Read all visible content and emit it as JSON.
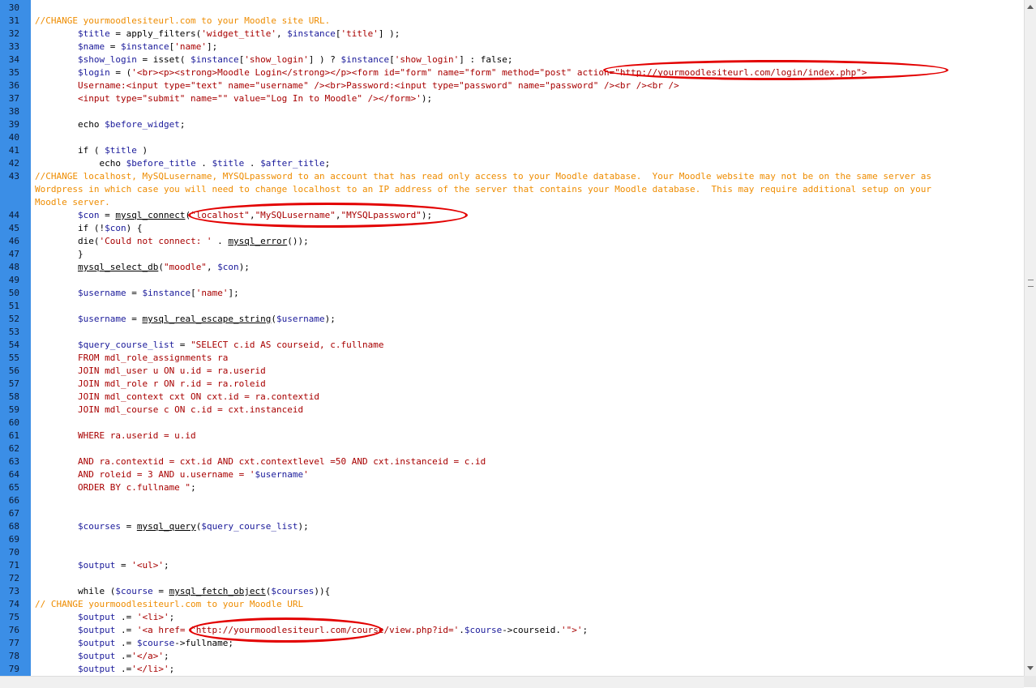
{
  "editor": {
    "lines": [
      {
        "n": "30",
        "segs": []
      },
      {
        "n": "31",
        "segs": [
          {
            "c": "cm",
            "t": "//CHANGE yourmoodlesiteurl.com to your Moodle site URL."
          }
        ]
      },
      {
        "n": "32",
        "segs": [
          {
            "c": "vr",
            "t": "        $title"
          },
          {
            "c": "pl",
            "t": " = apply_filters("
          },
          {
            "c": "st",
            "t": "'widget_title'"
          },
          {
            "c": "pl",
            "t": ", "
          },
          {
            "c": "vr",
            "t": "$instance"
          },
          {
            "c": "pl",
            "t": "["
          },
          {
            "c": "st",
            "t": "'title'"
          },
          {
            "c": "pl",
            "t": "] );"
          }
        ]
      },
      {
        "n": "33",
        "segs": [
          {
            "c": "vr",
            "t": "        $name"
          },
          {
            "c": "pl",
            "t": " = "
          },
          {
            "c": "vr",
            "t": "$instance"
          },
          {
            "c": "pl",
            "t": "["
          },
          {
            "c": "st",
            "t": "'name'"
          },
          {
            "c": "pl",
            "t": "];"
          }
        ]
      },
      {
        "n": "34",
        "segs": [
          {
            "c": "vr",
            "t": "        $show_login"
          },
          {
            "c": "pl",
            "t": " = isset( "
          },
          {
            "c": "vr",
            "t": "$instance"
          },
          {
            "c": "pl",
            "t": "["
          },
          {
            "c": "st",
            "t": "'show_login'"
          },
          {
            "c": "pl",
            "t": "] ) ? "
          },
          {
            "c": "vr",
            "t": "$instance"
          },
          {
            "c": "pl",
            "t": "["
          },
          {
            "c": "st",
            "t": "'show_login'"
          },
          {
            "c": "pl",
            "t": "] : false;"
          }
        ]
      },
      {
        "n": "35",
        "segs": [
          {
            "c": "vr",
            "t": "        $login"
          },
          {
            "c": "pl",
            "t": " = ("
          },
          {
            "c": "st",
            "t": "'<br><p><strong>Moodle Login</strong></p><form id=\"form\" name=\"form\" method=\"post\" action=\"http://yourmoodlesiteurl.com/login/index.php\">"
          }
        ]
      },
      {
        "n": "36",
        "segs": [
          {
            "c": "st",
            "t": "        Username:<input type=\"text\" name=\"username\" /><br>Password:<input type=\"password\" name=\"password\" /><br /><br />"
          }
        ]
      },
      {
        "n": "37",
        "segs": [
          {
            "c": "st",
            "t": "        <input type=\"submit\" name=\"\" value=\"Log In to Moodle\" /></form>'"
          },
          {
            "c": "pl",
            "t": ");"
          }
        ]
      },
      {
        "n": "38",
        "segs": []
      },
      {
        "n": "39",
        "segs": [
          {
            "c": "pl",
            "t": "        echo "
          },
          {
            "c": "vr",
            "t": "$before_widget"
          },
          {
            "c": "pl",
            "t": ";"
          }
        ]
      },
      {
        "n": "40",
        "segs": []
      },
      {
        "n": "41",
        "segs": [
          {
            "c": "pl",
            "t": "        if ( "
          },
          {
            "c": "vr",
            "t": "$title"
          },
          {
            "c": "pl",
            "t": " )"
          }
        ]
      },
      {
        "n": "42",
        "segs": [
          {
            "c": "pl",
            "t": "            echo "
          },
          {
            "c": "vr",
            "t": "$before_title"
          },
          {
            "c": "pl",
            "t": " . "
          },
          {
            "c": "vr",
            "t": "$title"
          },
          {
            "c": "pl",
            "t": " . "
          },
          {
            "c": "vr",
            "t": "$after_title"
          },
          {
            "c": "pl",
            "t": ";"
          }
        ]
      },
      {
        "n": "43",
        "segs": [
          {
            "c": "cm",
            "t": "//CHANGE localhost, MySQLusername, MYSQLpassword to an account that has read only access to your Moodle database.  Your Moodle website may not be on the same server as"
          }
        ]
      },
      {
        "n": "",
        "segs": [
          {
            "c": "cm",
            "t": "Wordpress in which case you will need to change localhost to an IP address of the server that contains your Moodle database.  This may require additional setup on your"
          }
        ]
      },
      {
        "n": "",
        "segs": [
          {
            "c": "cm",
            "t": "Moodle server."
          }
        ]
      },
      {
        "n": "44",
        "segs": [
          {
            "c": "vr",
            "t": "        $con"
          },
          {
            "c": "pl",
            "t": " = "
          },
          {
            "c": "fn",
            "t": "mysql_connect"
          },
          {
            "c": "pl",
            "t": "("
          },
          {
            "c": "st",
            "t": "\"localhost\""
          },
          {
            "c": "pl",
            "t": ","
          },
          {
            "c": "st",
            "t": "\"MySQLusername\""
          },
          {
            "c": "pl",
            "t": ","
          },
          {
            "c": "st",
            "t": "\"MYSQLpassword\""
          },
          {
            "c": "pl",
            "t": ");"
          }
        ]
      },
      {
        "n": "45",
        "segs": [
          {
            "c": "pl",
            "t": "        if (!"
          },
          {
            "c": "vr",
            "t": "$con"
          },
          {
            "c": "pl",
            "t": ") {"
          }
        ]
      },
      {
        "n": "46",
        "segs": [
          {
            "c": "pl",
            "t": "        die("
          },
          {
            "c": "st",
            "t": "'Could not connect: '"
          },
          {
            "c": "pl",
            "t": " . "
          },
          {
            "c": "fn",
            "t": "mysql_error"
          },
          {
            "c": "pl",
            "t": "());"
          }
        ]
      },
      {
        "n": "47",
        "segs": [
          {
            "c": "pl",
            "t": "        }"
          }
        ]
      },
      {
        "n": "48",
        "segs": [
          {
            "c": "pl",
            "t": "        "
          },
          {
            "c": "fn",
            "t": "mysql_select_db"
          },
          {
            "c": "pl",
            "t": "("
          },
          {
            "c": "st",
            "t": "\"moodle\""
          },
          {
            "c": "pl",
            "t": ", "
          },
          {
            "c": "vr",
            "t": "$con"
          },
          {
            "c": "pl",
            "t": ");"
          }
        ]
      },
      {
        "n": "49",
        "segs": []
      },
      {
        "n": "50",
        "segs": [
          {
            "c": "vr",
            "t": "        $username"
          },
          {
            "c": "pl",
            "t": " = "
          },
          {
            "c": "vr",
            "t": "$instance"
          },
          {
            "c": "pl",
            "t": "["
          },
          {
            "c": "st",
            "t": "'name'"
          },
          {
            "c": "pl",
            "t": "];"
          }
        ]
      },
      {
        "n": "51",
        "segs": []
      },
      {
        "n": "52",
        "segs": [
          {
            "c": "vr",
            "t": "        $username"
          },
          {
            "c": "pl",
            "t": " = "
          },
          {
            "c": "fn",
            "t": "mysql_real_escape_string"
          },
          {
            "c": "pl",
            "t": "("
          },
          {
            "c": "vr",
            "t": "$username"
          },
          {
            "c": "pl",
            "t": ");"
          }
        ]
      },
      {
        "n": "53",
        "segs": []
      },
      {
        "n": "54",
        "segs": [
          {
            "c": "vr",
            "t": "        $query_course_list"
          },
          {
            "c": "pl",
            "t": " = "
          },
          {
            "c": "st",
            "t": "\"SELECT c.id AS courseid, c.fullname"
          }
        ]
      },
      {
        "n": "55",
        "segs": [
          {
            "c": "st",
            "t": "        FROM mdl_role_assignments ra"
          }
        ]
      },
      {
        "n": "56",
        "segs": [
          {
            "c": "st",
            "t": "        JOIN mdl_user u ON u.id = ra.userid"
          }
        ]
      },
      {
        "n": "57",
        "segs": [
          {
            "c": "st",
            "t": "        JOIN mdl_role r ON r.id = ra.roleid"
          }
        ]
      },
      {
        "n": "58",
        "segs": [
          {
            "c": "st",
            "t": "        JOIN mdl_context cxt ON cxt.id = ra.contextid"
          }
        ]
      },
      {
        "n": "59",
        "segs": [
          {
            "c": "st",
            "t": "        JOIN mdl_course c ON c.id = cxt.instanceid"
          }
        ]
      },
      {
        "n": "60",
        "segs": []
      },
      {
        "n": "61",
        "segs": [
          {
            "c": "st",
            "t": "        WHERE ra.userid = u.id"
          }
        ]
      },
      {
        "n": "62",
        "segs": []
      },
      {
        "n": "63",
        "segs": [
          {
            "c": "st",
            "t": "        AND ra.contextid = cxt.id AND cxt.contextlevel =50 AND cxt.instanceid = c.id"
          }
        ]
      },
      {
        "n": "64",
        "segs": [
          {
            "c": "st",
            "t": "        AND roleid = 3 AND u.username = '"
          },
          {
            "c": "vr",
            "t": "$username"
          },
          {
            "c": "st",
            "t": "'"
          }
        ]
      },
      {
        "n": "65",
        "segs": [
          {
            "c": "st",
            "t": "        ORDER BY c.fullname \""
          },
          {
            "c": "pl",
            "t": ";"
          }
        ]
      },
      {
        "n": "66",
        "segs": []
      },
      {
        "n": "67",
        "segs": []
      },
      {
        "n": "68",
        "segs": [
          {
            "c": "vr",
            "t": "        $courses"
          },
          {
            "c": "pl",
            "t": " = "
          },
          {
            "c": "fn",
            "t": "mysql_query"
          },
          {
            "c": "pl",
            "t": "("
          },
          {
            "c": "vr",
            "t": "$query_course_list"
          },
          {
            "c": "pl",
            "t": ");"
          }
        ]
      },
      {
        "n": "69",
        "segs": []
      },
      {
        "n": "70",
        "segs": []
      },
      {
        "n": "71",
        "segs": [
          {
            "c": "vr",
            "t": "        $output"
          },
          {
            "c": "pl",
            "t": " = "
          },
          {
            "c": "st",
            "t": "'<ul>'"
          },
          {
            "c": "pl",
            "t": ";"
          }
        ]
      },
      {
        "n": "72",
        "segs": []
      },
      {
        "n": "73",
        "segs": [
          {
            "c": "pl",
            "t": "        while ("
          },
          {
            "c": "vr",
            "t": "$course"
          },
          {
            "c": "pl",
            "t": " = "
          },
          {
            "c": "fn",
            "t": "mysql_fetch_object"
          },
          {
            "c": "pl",
            "t": "("
          },
          {
            "c": "vr",
            "t": "$courses"
          },
          {
            "c": "pl",
            "t": ")){"
          }
        ]
      },
      {
        "n": "74",
        "segs": [
          {
            "c": "cm",
            "t": "// CHANGE yourmoodlesiteurl.com to your Moodle URL"
          }
        ]
      },
      {
        "n": "75",
        "segs": [
          {
            "c": "vr",
            "t": "        $output"
          },
          {
            "c": "pl",
            "t": " .= "
          },
          {
            "c": "st",
            "t": "'<li>'"
          },
          {
            "c": "pl",
            "t": ";"
          }
        ]
      },
      {
        "n": "76",
        "segs": [
          {
            "c": "vr",
            "t": "        $output"
          },
          {
            "c": "pl",
            "t": " .= "
          },
          {
            "c": "st",
            "t": "'<a href= \"http://yourmoodlesiteurl.com/course/view.php?id='"
          },
          {
            "c": "pl",
            "t": "."
          },
          {
            "c": "vr",
            "t": "$course"
          },
          {
            "c": "pl",
            "t": "->courseid."
          },
          {
            "c": "st",
            "t": "'\">'"
          },
          {
            "c": "pl",
            "t": ";"
          }
        ]
      },
      {
        "n": "77",
        "segs": [
          {
            "c": "vr",
            "t": "        $output"
          },
          {
            "c": "pl",
            "t": " .= "
          },
          {
            "c": "vr",
            "t": "$course"
          },
          {
            "c": "pl",
            "t": "->fullname;"
          }
        ]
      },
      {
        "n": "78",
        "segs": [
          {
            "c": "vr",
            "t": "        $output"
          },
          {
            "c": "pl",
            "t": " .="
          },
          {
            "c": "st",
            "t": "'</a>'"
          },
          {
            "c": "pl",
            "t": ";"
          }
        ]
      },
      {
        "n": "79",
        "segs": [
          {
            "c": "vr",
            "t": "        $output"
          },
          {
            "c": "pl",
            "t": " .="
          },
          {
            "c": "st",
            "t": "'</li>'"
          },
          {
            "c": "pl",
            "t": ";"
          }
        ]
      }
    ]
  },
  "colors": {
    "gutter": "#3b8ee6",
    "comment": "#ee8c00",
    "string": "#a80000",
    "variable": "#1a1a9a",
    "highlight": "#e30000"
  },
  "annotations": [
    {
      "name": "highlight-form-action",
      "label": "action=\"http://yourmoodlesiteurl.com/login/index.php\""
    },
    {
      "name": "highlight-db-credentials",
      "label": "(\"localhost\",\"MySQLusername\",\"MYSQLpassword\");"
    },
    {
      "name": "highlight-course-url",
      "label": "= \"http://yourmoodlesiteurl.com/c"
    }
  ]
}
